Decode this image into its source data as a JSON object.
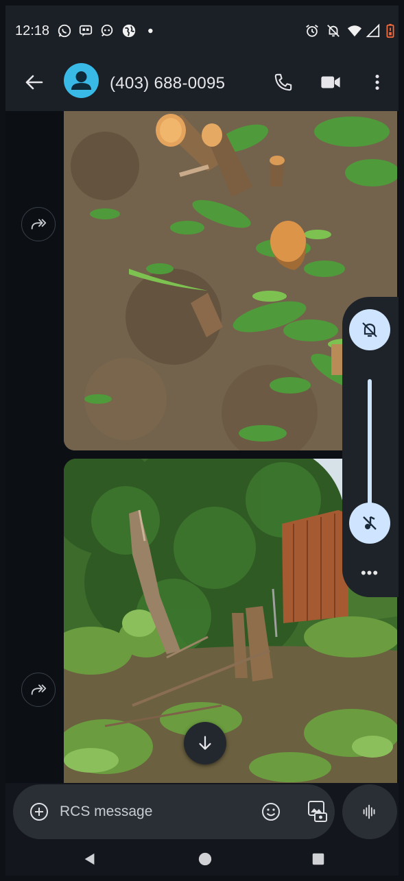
{
  "status_bar": {
    "time": "12:18",
    "left_icons": [
      "whatsapp-icon",
      "message-bubble-icon",
      "chat-head-icon",
      "globe-icon",
      "dot-icon"
    ],
    "right_icons": [
      "alarm-icon",
      "notifications-off-icon",
      "wifi-icon",
      "signal-icon",
      "battery-icon"
    ]
  },
  "app_bar": {
    "contact_name": "(403) 688-0095",
    "actions": [
      "phone-icon",
      "video-call-icon",
      "more-vert-icon"
    ]
  },
  "messages": [
    {
      "type": "image",
      "content": "photo of cut tree stumps and small logs on ground with green weeds",
      "forward_icon": "forward-icon"
    },
    {
      "type": "image",
      "content": "photo of cut tree stumps and branches in garden in front of hedges and fence",
      "forward_icon": "forward-icon"
    }
  ],
  "volume_panel": {
    "ringer_icon": "ringer-off-icon",
    "media_icon": "music-off-icon",
    "level": 1.0,
    "more_label": "•••"
  },
  "compose": {
    "placeholder": "RCS message",
    "plus_icon": "add-circle-icon",
    "emoji_icon": "emoji-icon",
    "gallery_icon": "gallery-icon",
    "voice_icon": "voice-waveform-icon"
  },
  "nav_bar": {
    "buttons": [
      "back-triangle-icon",
      "home-circle-icon",
      "recents-square-icon"
    ]
  },
  "colors": {
    "accent": "#39b9e6",
    "panel_highlight": "#cfe4ff",
    "background": "#13161c"
  }
}
